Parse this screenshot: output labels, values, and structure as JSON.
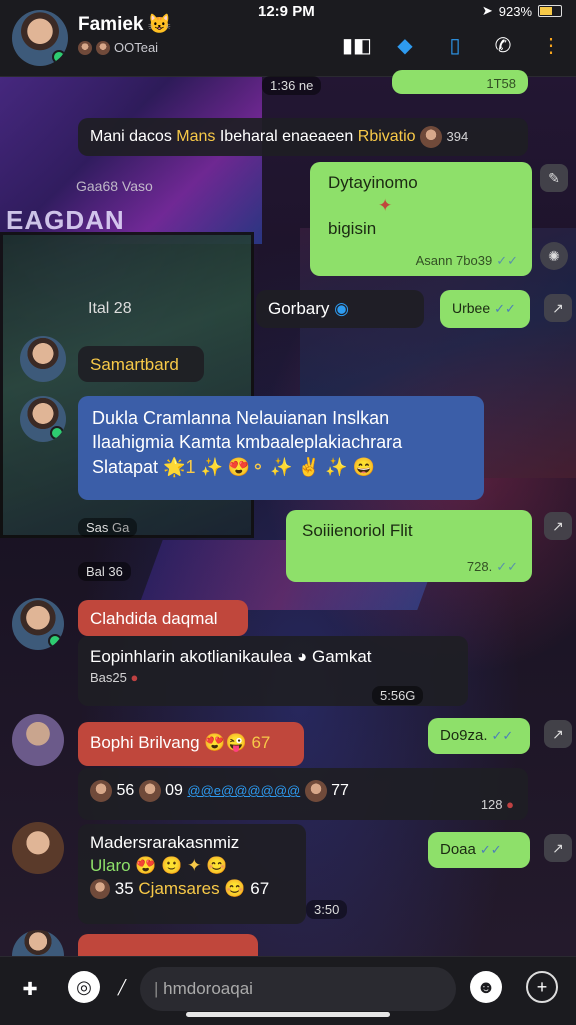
{
  "status_bar": {
    "time": "12:9 PM",
    "battery": "923%"
  },
  "header": {
    "title": "Famiek",
    "title_emoji": "😺",
    "subtitle": "OOTeai",
    "icons": [
      "video-call-icon",
      "share-icon",
      "phone-book-icon",
      "phone-icon",
      "more-icon"
    ]
  },
  "wallpaper_text": {
    "poster": "EAGDAN",
    "poster_small": "Gaa68 Vaso",
    "screen_label": "Ital 28"
  },
  "messages": {
    "top_partial_time": "1T58",
    "chip_1": "1:36 ne",
    "pinned": {
      "a": "Mani dacos",
      "b": "Mans",
      "c": "Ibeharal enaeaeen",
      "d": "Rbivatio",
      "count": "394"
    },
    "out_1": {
      "line1": "Dytayinomo",
      "line2": "bigisin",
      "time": "Asann 7bo39"
    },
    "in_1": {
      "text": "Gorbary",
      "time": "Urbee"
    },
    "sender_1": "Samartbard",
    "blue_1": {
      "line1": "Dukla Cramlanna Nelauianan Inslkan",
      "line2": "Ilaahigmia Kamta kmbaaleplakiachrara",
      "line3": "Slatapat",
      "emojis": "🌟1 ✨ 😍⚬ ✨ ✌ ✨ 😄"
    },
    "chip_2": "Sas",
    "chip_2b": "Ga",
    "out_2": {
      "text": "Soiiienoriol Flit",
      "time": "728."
    },
    "chip_3": "Bal 36",
    "red_1": "Clahdida daqmal",
    "in_2": {
      "text": "Eopinhlarin akotlianikaulea",
      "tag": "Gamkat",
      "meta": "Bas25"
    },
    "chip_4": "5:56G",
    "red_2": {
      "text": "Bophi Brilvang",
      "emojis": "😍😜",
      "num": "67"
    },
    "in_3": {
      "n1": "56",
      "n2": "09",
      "link": "@@e@@@@@@",
      "n3": "77",
      "time": "128"
    },
    "out_3": {
      "text": "Do9za."
    },
    "in_4": {
      "line1": "Madersrarakasnmiz",
      "line2": "Ularo",
      "line3_num": "35",
      "line3_text": "Cjamsares",
      "line3_end": "67"
    },
    "chip_5": "3:50",
    "out_4": {
      "text": "Doaa"
    }
  },
  "input": {
    "placeholder": "hmdoroaqai"
  }
}
